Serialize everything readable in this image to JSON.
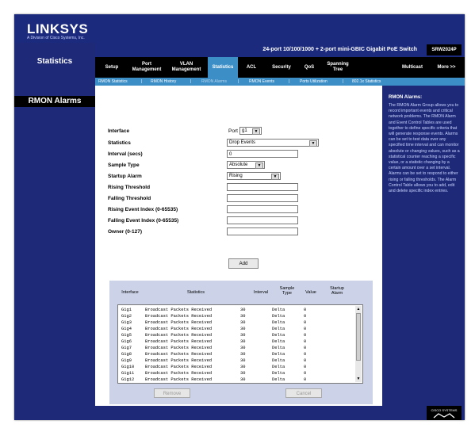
{
  "brand": {
    "logo": "LINKSYS",
    "tagline": "A Division of Cisco Systems, Inc."
  },
  "header": {
    "product": "24-port 10/100/1000 + 2-port mini-GBIC Gigabit PoE Switch",
    "model": "SRW2024P"
  },
  "section": "Statistics",
  "page_title": "RMON Alarms",
  "tabs": [
    {
      "label": "Setup"
    },
    {
      "label": "Port Management"
    },
    {
      "label": "VLAN Management"
    },
    {
      "label": "Statistics"
    },
    {
      "label": "ACL"
    },
    {
      "label": "Security"
    },
    {
      "label": "QoS"
    },
    {
      "label": "Spanning Tree"
    },
    {
      "label": "Multicast"
    },
    {
      "label": "More >>"
    }
  ],
  "subnav": [
    {
      "label": "RMON Statistics"
    },
    {
      "label": "RMON History"
    },
    {
      "label": "RMON Alarms"
    },
    {
      "label": "RMON Events"
    },
    {
      "label": "Ports Utilization"
    },
    {
      "label": "802.1x Statistics"
    }
  ],
  "form": {
    "interface_label": "Interface",
    "port_label": "Port",
    "port_value": "g1",
    "statistics_label": "Statistics",
    "statistics_value": "Drop Events",
    "interval_label": "Interval (secs)",
    "interval_value": "0",
    "sample_type_label": "Sample Type",
    "sample_type_value": "Absolute",
    "startup_alarm_label": "Startup Alarm",
    "startup_alarm_value": "Rising",
    "rising_threshold_label": "Rising Threshold",
    "falling_threshold_label": "Falling Threshold",
    "rising_event_label": "Rising Event Index (0-65535)",
    "falling_event_label": "Falling Event Index (0-65535)",
    "owner_label": "Owner (0-127)",
    "add_label": "Add"
  },
  "table": {
    "headers": [
      "Interface",
      "Statistics",
      "Interval",
      "Sample Type",
      "Value",
      "Startup Alarm"
    ],
    "rows": [
      [
        "G1g1",
        "Broadcast Packets Received",
        "30",
        "Delta",
        "0"
      ],
      [
        "G1g2",
        "Broadcast Packets Received",
        "30",
        "Delta",
        "0"
      ],
      [
        "G1g3",
        "Broadcast Packets Received",
        "30",
        "Delta",
        "0"
      ],
      [
        "G1g4",
        "Broadcast Packets Received",
        "30",
        "Delta",
        "0"
      ],
      [
        "G1g5",
        "Broadcast Packets Received",
        "30",
        "Delta",
        "0"
      ],
      [
        "G1g6",
        "Broadcast Packets Received",
        "30",
        "Delta",
        "0"
      ],
      [
        "G1g7",
        "Broadcast Packets Received",
        "30",
        "Delta",
        "0"
      ],
      [
        "G1g8",
        "Broadcast Packets Received",
        "30",
        "Delta",
        "0"
      ],
      [
        "G1g9",
        "Broadcast Packets Received",
        "30",
        "Delta",
        "0"
      ],
      [
        "G1g10",
        "Broadcast Packets Received",
        "30",
        "Delta",
        "0"
      ],
      [
        "G1g11",
        "Broadcast Packets Received",
        "30",
        "Delta",
        "0"
      ],
      [
        "G1g12",
        "Broadcast Packets Received",
        "30",
        "Delta",
        "0"
      ]
    ],
    "remove_label": "Remove",
    "cancel_label": "Cancel"
  },
  "help": {
    "title": "RMON Alarms:",
    "text": "The RMON Alarm Group allows you to record important events and critical network problems. The RMON Alarm and Event Control Tables are used together to define specific criteria that will generate response events. Alarms can be set to test data over any specified time interval and can monitor absolute or changing values, such as a statistical counter reaching a specific value, or a statistic changing by a certain amount over a set interval. Alarms can be set to respond to either rising or falling thresholds. The Alarm Control Table allows you to add, edit and delete specific index entries."
  },
  "footer": {
    "vendor": "CISCO SYSTEMS"
  }
}
